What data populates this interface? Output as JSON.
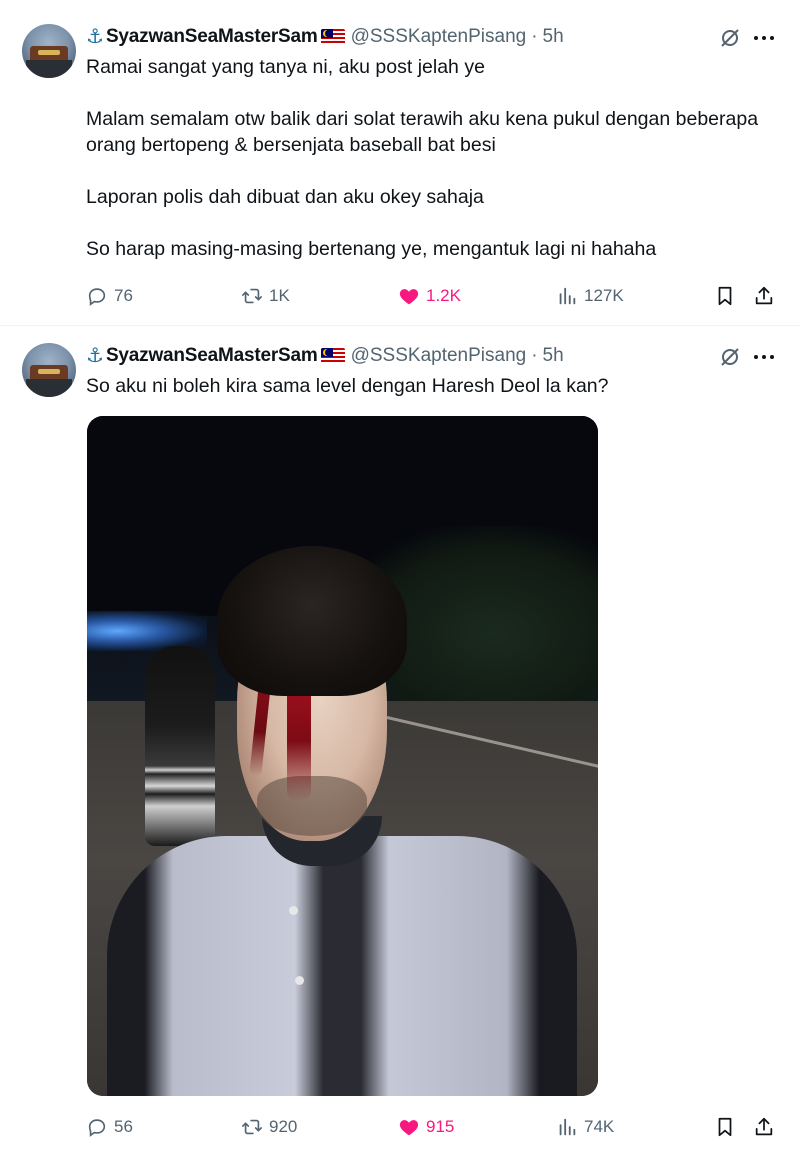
{
  "tweets": [
    {
      "display_name": "SyazwanSeaMasterSam",
      "handle": "@SSSKaptenPisang",
      "separator": "·",
      "time": "5h",
      "paragraphs": [
        "Ramai sangat yang tanya ni, aku post jelah ye",
        "Malam semalam otw balik dari solat terawih aku kena pukul dengan beberapa orang bertopeng & bersenjata baseball bat besi",
        "Laporan polis dah dibuat dan aku okey sahaja",
        "So harap masing-masing bertenang ye, mengantuk lagi ni hahaha"
      ],
      "stats": {
        "replies": "76",
        "reposts": "1K",
        "likes": "1.2K",
        "views": "127K"
      },
      "liked": true
    },
    {
      "display_name": "SyazwanSeaMasterSam",
      "handle": "@SSSKaptenPisang",
      "separator": "·",
      "time": "5h",
      "paragraphs": [
        "So aku ni boleh kira sama level dengan Haresh Deol la kan?"
      ],
      "has_media": true,
      "stats": {
        "replies": "56",
        "reposts": "920",
        "likes": "915",
        "views": "74K"
      },
      "liked": true
    }
  ],
  "icons": {
    "name_prefix": "anchor-emoji",
    "flag": "malaysia-flag",
    "grok": "grok-icon",
    "more": "more-icon",
    "reply": "reply-icon",
    "repost": "repost-icon",
    "like": "heart-filled-icon",
    "views": "views-icon",
    "bookmark": "bookmark-icon",
    "share": "share-icon"
  },
  "colors": {
    "text_primary": "#0f1419",
    "text_secondary": "#536471",
    "like_active": "#f91880",
    "divider": "#eff3f4"
  }
}
